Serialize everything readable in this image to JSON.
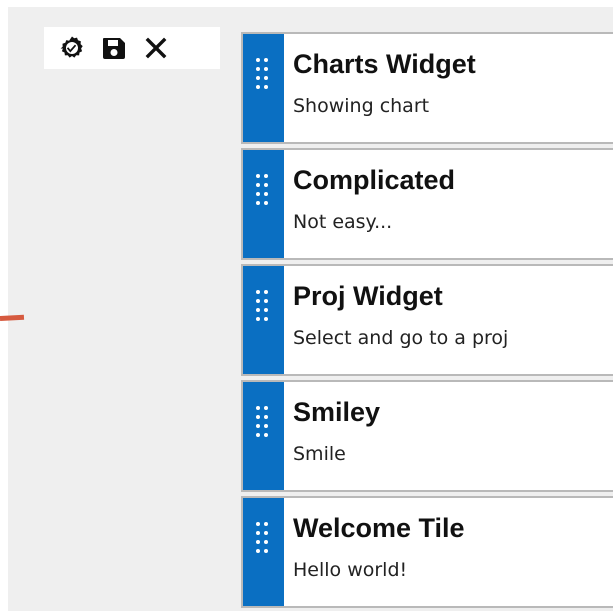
{
  "toolbar": {
    "icons": [
      "settings-icon",
      "save-icon",
      "close-icon"
    ]
  },
  "widgets": [
    {
      "title": "Charts Widget",
      "subtitle": "Showing chart"
    },
    {
      "title": "Complicated",
      "subtitle": "Not easy..."
    },
    {
      "title": "Proj Widget",
      "subtitle": "Select and go to a proj"
    },
    {
      "title": "Smiley",
      "subtitle": "Smile"
    },
    {
      "title": "Welcome Tile",
      "subtitle": "Hello world!"
    }
  ],
  "colors": {
    "handle": "#0a6fc2",
    "panel": "#efefef",
    "accent_mark": "#d65a3f"
  }
}
